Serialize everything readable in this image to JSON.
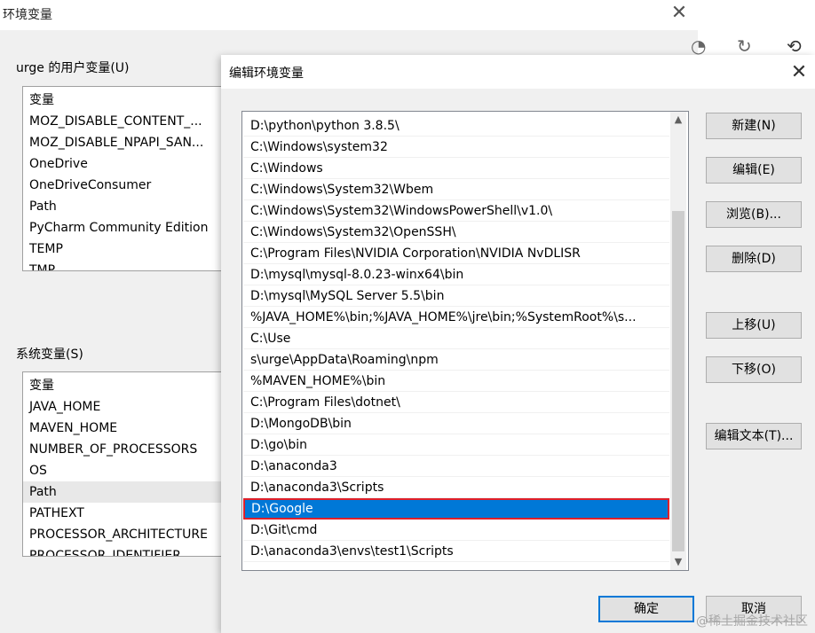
{
  "bg_window": {
    "title": "环境变量",
    "user_group_label": "urge 的用户变量(U)",
    "user_vars_header": "变量",
    "user_vars": [
      "MOZ_DISABLE_CONTENT_...",
      "MOZ_DISABLE_NPAPI_SAN...",
      "OneDrive",
      "OneDriveConsumer",
      "Path",
      "PyCharm Community Edition",
      "TEMP",
      "TMP"
    ],
    "system_group_label": "系统变量(S)",
    "system_vars_header": "变量",
    "system_vars": [
      "JAVA_HOME",
      "MAVEN_HOME",
      "NUMBER_OF_PROCESSORS",
      "OS",
      "Path",
      "PATHEXT",
      "PROCESSOR_ARCHITECTURE",
      "PROCESSOR_IDENTIFIER"
    ]
  },
  "browser": {
    "refresh_icon": "↻",
    "history_icon": "⟲"
  },
  "dialog": {
    "title": "编辑环境变量",
    "close_glyph": "✕",
    "paths": [
      "D:\\python\\python 3.8.5\\",
      "C:\\Windows\\system32",
      "C:\\Windows",
      "C:\\Windows\\System32\\Wbem",
      "C:\\Windows\\System32\\WindowsPowerShell\\v1.0\\",
      "C:\\Windows\\System32\\OpenSSH\\",
      "C:\\Program Files\\NVIDIA Corporation\\NVIDIA NvDLISR",
      "D:\\mysql\\mysql-8.0.23-winx64\\bin",
      "D:\\mysql\\MySQL Server 5.5\\bin",
      "%JAVA_HOME%\\bin;%JAVA_HOME%\\jre\\bin;%SystemRoot%\\s...",
      "C:\\Use",
      "s\\urge\\AppData\\Roaming\\npm",
      "%MAVEN_HOME%\\bin",
      "C:\\Program Files\\dotnet\\",
      "D:\\MongoDB\\bin",
      "D:\\go\\bin",
      "D:\\anaconda3",
      "D:\\anaconda3\\Scripts",
      "D:\\Google",
      "D:\\Git\\cmd",
      "D:\\anaconda3\\envs\\test1\\Scripts"
    ],
    "selected_index": 18,
    "buttons": {
      "new": "新建(N)",
      "edit": "编辑(E)",
      "browse": "浏览(B)...",
      "delete": "删除(D)",
      "move_up": "上移(U)",
      "move_down": "下移(O)",
      "edit_text": "编辑文本(T)...",
      "ok": "确定",
      "cancel": "取消"
    }
  },
  "watermark": "@稀土掘金技术社区",
  "colors": {
    "selection": "#0078d7",
    "highlight_border": "#e0202a"
  }
}
